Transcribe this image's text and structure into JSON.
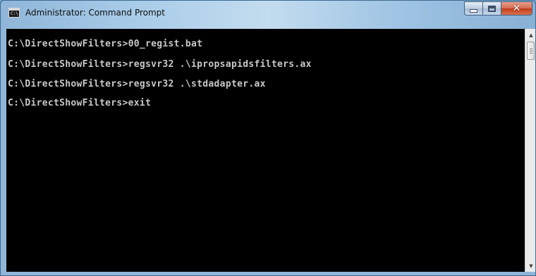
{
  "window": {
    "title": "Administrator: Command Prompt",
    "icon": {
      "name": "command-prompt-icon",
      "text": "C:\\"
    }
  },
  "controls": {
    "minimize": "minimize-icon",
    "maximize": "maximize-icon",
    "close": "close-icon",
    "close_glyph": "✕"
  },
  "console": {
    "lines": [
      "C:\\DirectShowFilters>00_regist.bat",
      "C:\\DirectShowFilters>regsvr32 .\\ipropsapidsfilters.ax",
      "C:\\DirectShowFilters>regsvr32 .\\stdadapter.ax",
      "C:\\DirectShowFilters>exit"
    ]
  },
  "scrollbar": {
    "up_arrow": "▲",
    "down_arrow": "▼"
  },
  "colors": {
    "console_background": "#000000",
    "console_text": "#c9c9c9",
    "close_button": "#c23b1c"
  }
}
